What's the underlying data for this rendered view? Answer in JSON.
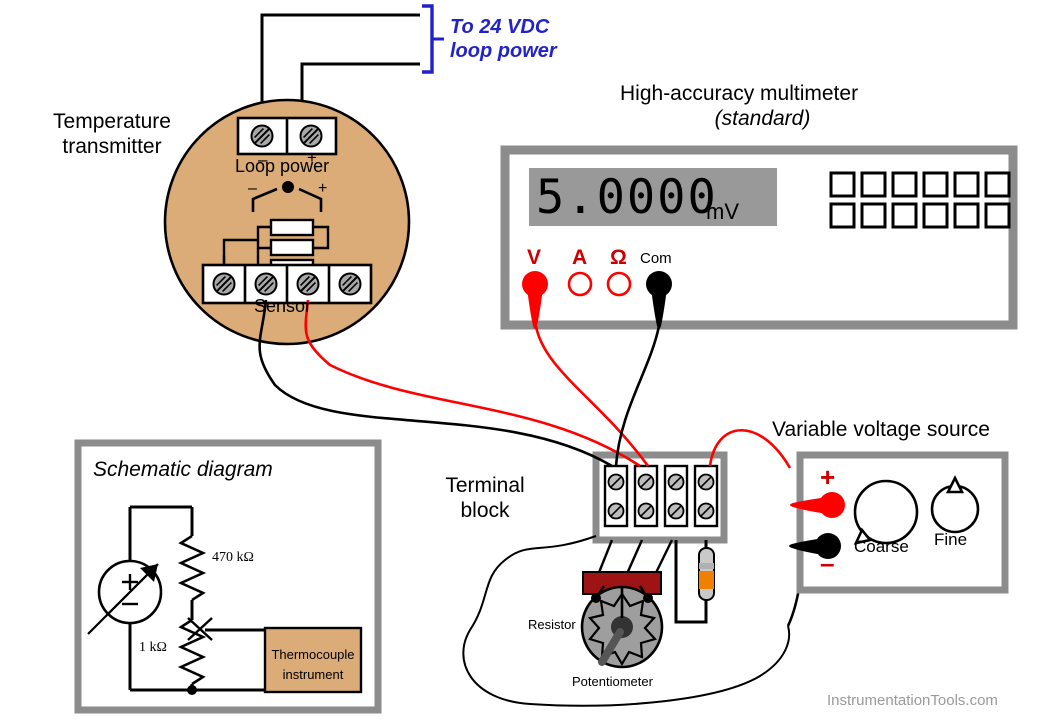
{
  "watermark": "InstrumentationTools.com",
  "annotations": {
    "loop_power_note": "To 24 VDC\nloop power",
    "transmitter_title": "Temperature\ntransmitter",
    "multimeter_title": "High-accuracy multimeter",
    "multimeter_subtitle": "(standard)",
    "terminal_block_title": "Terminal\nblock",
    "voltage_source_title": "Variable voltage source",
    "schematic_title": "Schematic diagram"
  },
  "transmitter": {
    "loop_power_label": "Loop power",
    "loop_power_terminals": [
      {
        "mark": "–"
      },
      {
        "mark": "+"
      }
    ],
    "sensor_label": "Sensor",
    "sensor_terminals": [
      {
        "id": "s1"
      },
      {
        "id": "s2"
      },
      {
        "id": "s3"
      },
      {
        "id": "s4"
      }
    ],
    "junction_minus": "–",
    "junction_plus": "+",
    "body_color": "#dbab78"
  },
  "multimeter": {
    "display_value": "5.0000",
    "display_units": "mV",
    "display_bg": "#999999",
    "jacks": [
      {
        "label": "V",
        "color": "#ff0000",
        "filled": true
      },
      {
        "label": "A",
        "color": "#ff0000",
        "filled": false
      },
      {
        "label": "Ω",
        "color": "#ff0000",
        "filled": false
      },
      {
        "label": "Com",
        "color": "#000000",
        "filled": true
      }
    ],
    "button_rows": 2,
    "button_cols": 6
  },
  "terminal_block": {
    "slot_count": 4,
    "screws_per_slot": 2,
    "frame_color": "#8c8c8c"
  },
  "components": {
    "resistor_label": "Resistor",
    "potentiometer_label": "Potentiometer",
    "pot_body_color": "#9e9e9e",
    "pot_strip_color": "#9e1414",
    "resistor_band_color": "#f08000"
  },
  "voltage_source": {
    "plus_label": "+",
    "minus_label": "–",
    "knobs": [
      {
        "label": "Coarse"
      },
      {
        "label": "Fine"
      }
    ],
    "frame_color": "#8c8c8c"
  },
  "schematic": {
    "title": "Schematic diagram",
    "resistor_top_label": "470 kΩ",
    "resistor_bottom_label": "1 kΩ",
    "instrument_box_line1": "Thermocouple",
    "instrument_box_line2": "instrument",
    "instrument_box_color": "#dbab78",
    "source_plus": "+",
    "source_minus": "–",
    "frame_color": "#8c8c8c"
  },
  "colors": {
    "red_wire": "#ff0000",
    "black_wire": "#000000",
    "blue_annotation": "#2222cc",
    "gray_frame": "#8c8c8c"
  }
}
